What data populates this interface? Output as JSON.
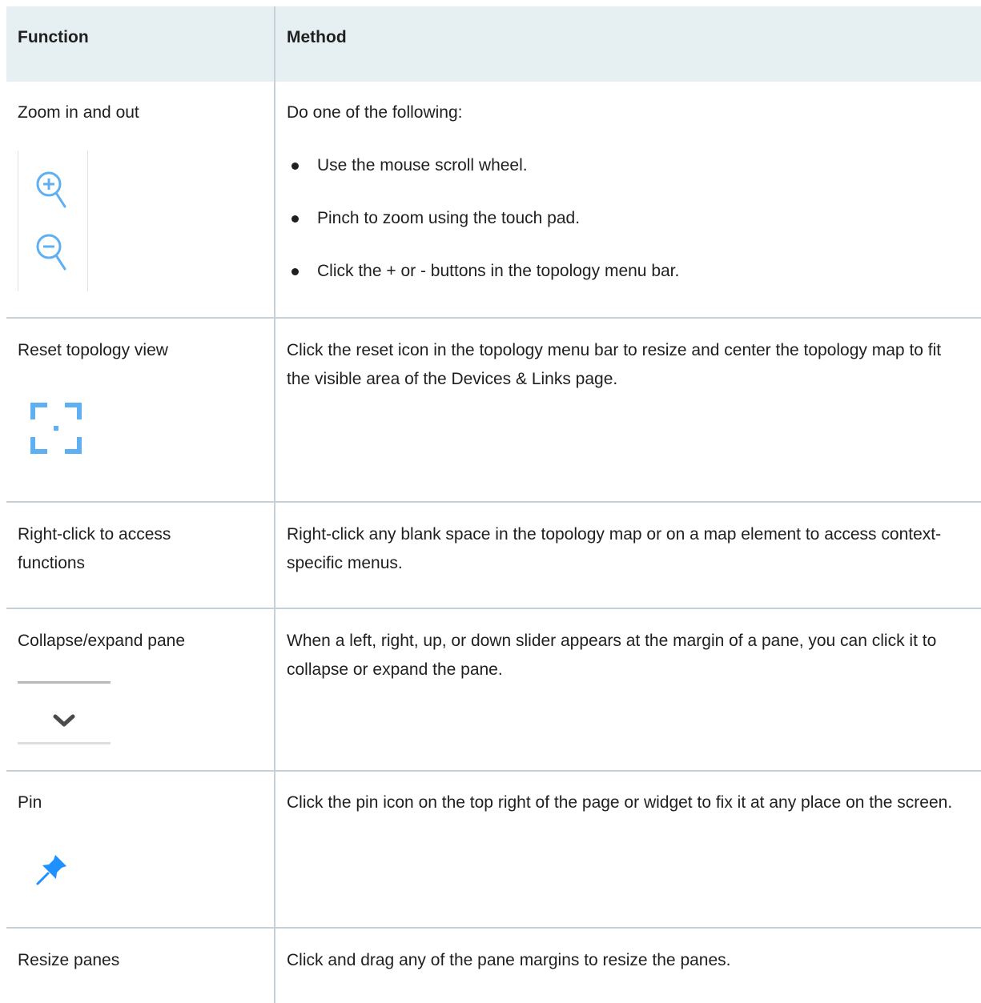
{
  "table": {
    "headers": {
      "function": "Function",
      "method": "Method"
    },
    "rows": [
      {
        "function": "Zoom in and out",
        "icons": [
          "zoom-in-icon",
          "zoom-out-icon"
        ],
        "method_intro": "Do one of the following:",
        "method_bullets": [
          "Use the mouse scroll wheel.",
          "Pinch to zoom using the touch pad.",
          "Click the + or - buttons in the topology menu bar."
        ]
      },
      {
        "function": "Reset topology view",
        "icons": [
          "reset-view-icon"
        ],
        "method": "Click the reset icon in the topology menu bar to resize and center the topology map to fit the visible area of the Devices & Links page."
      },
      {
        "function": "Right-click to access functions",
        "method": "Right-click any blank space in the topology map or on a map element to access context-specific menus."
      },
      {
        "function": "Collapse/expand pane",
        "icons": [
          "chevron-down-icon"
        ],
        "method": "When a left, right, up, or down slider appears at the margin of a pane, you can click it to collapse or expand the pane."
      },
      {
        "function": "Pin",
        "icons": [
          "pin-icon"
        ],
        "method": "Click the pin icon on the top right of the page or widget to fix it at any place on the screen."
      },
      {
        "function": "Resize panes",
        "method": "Click and drag any of the pane margins to resize the panes."
      }
    ]
  },
  "colors": {
    "header_bg": "#e6eff2",
    "grid_line": "#c7d0d6",
    "icon_blue": "#5fb0f2",
    "pin_blue": "#1e90ff",
    "chevron_gray": "#4a4a4a"
  }
}
